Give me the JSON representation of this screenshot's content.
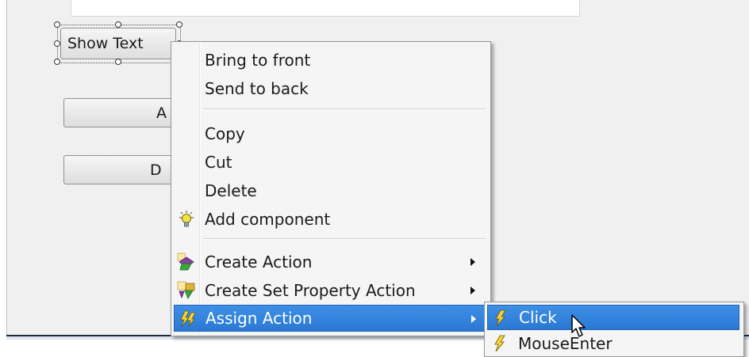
{
  "canvas": {
    "show_text_button": "Show Text",
    "button2_label": "A",
    "button3_label": "D"
  },
  "context_menu": {
    "items": [
      {
        "label": "Bring to front"
      },
      {
        "label": "Send to back"
      },
      {
        "label": "Copy"
      },
      {
        "label": "Cut"
      },
      {
        "label": "Delete"
      },
      {
        "label": "Add component",
        "icon": "lightbulb-icon"
      },
      {
        "label": "Create Action",
        "icon": "create-action-icon",
        "submenu": true
      },
      {
        "label": "Create Set Property Action",
        "icon": "set-property-icon",
        "submenu": true
      },
      {
        "label": "Assign Action",
        "icon": "lightning-icon",
        "submenu": true,
        "highlighted": true
      }
    ]
  },
  "submenu": {
    "items": [
      {
        "label": "Click",
        "icon": "lightning-icon",
        "highlighted": true
      },
      {
        "label": "MouseEnter",
        "icon": "lightning-icon"
      }
    ]
  },
  "colors": {
    "highlight": "#2a78d3",
    "menu_bg": "#f5f5f5",
    "canvas_bg": "#f0f0f0"
  }
}
